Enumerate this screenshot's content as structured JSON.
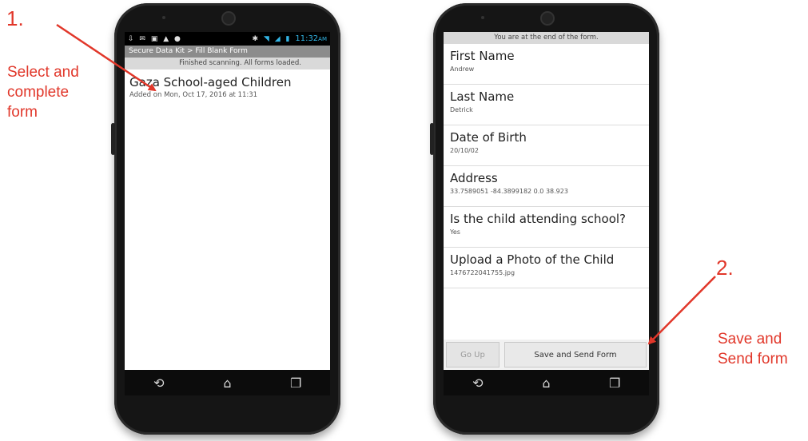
{
  "annotations": {
    "step1_num": "1.",
    "step1_text": [
      "Select and",
      "complete",
      "form"
    ],
    "step2_num": "2.",
    "step2_text": [
      "Save and",
      "Send form"
    ],
    "arrow_color": "#e1372a"
  },
  "phone1": {
    "status_time": "11:32",
    "status_ampm": "AM",
    "title": "Secure Data Kit > Fill Blank Form",
    "banner": "Finished scanning. All forms loaded.",
    "form_title": "Gaza School-aged Children",
    "form_subtitle": "Added on Mon, Oct 17, 2016 at 11:31"
  },
  "phone2": {
    "banner": "You are at the end of the form.",
    "fields": [
      {
        "label": "First Name",
        "value": "Andrew"
      },
      {
        "label": "Last Name",
        "value": "Detrick"
      },
      {
        "label": "Date of Birth",
        "value": "20/10/02"
      },
      {
        "label": "Address",
        "value": "33.7589051 -84.3899182 0.0 38.923"
      },
      {
        "label": "Is the child attending school?",
        "value": "Yes"
      },
      {
        "label": "Upload a Photo of the Child",
        "value": "1476722041755.jpg"
      }
    ],
    "go_up_label": "Go Up",
    "save_send_label": "Save and Send Form"
  },
  "nav_icons": [
    "back-icon",
    "home-icon",
    "recent-apps-icon"
  ]
}
